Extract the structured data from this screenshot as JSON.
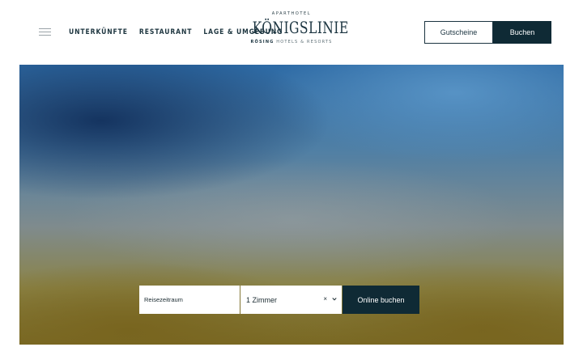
{
  "header": {
    "menu_icon": "hamburger-icon",
    "nav": [
      {
        "label": "UNTERKÜNFTE"
      },
      {
        "label": "RESTAURANT"
      },
      {
        "label": "LAGE & UMGEBUNG"
      }
    ],
    "logo": {
      "overline": "APARTHOTEL",
      "wordmark": "KÖNIGSLINIE",
      "brand_bold": "RÖSING",
      "brand_rest": " HOTELS & RESORTS"
    },
    "voucher_label": "Gutscheine",
    "book_label": "Buchen"
  },
  "booking": {
    "date_label": "Reisezeitraum",
    "rooms_value": "1 Zimmer",
    "clear_icon": "close-icon",
    "dropdown_icon": "chevron-down-icon",
    "submit_label": "Online buchen"
  },
  "colors": {
    "accent_dark": "#0f2a35",
    "text": "#1b3440"
  }
}
